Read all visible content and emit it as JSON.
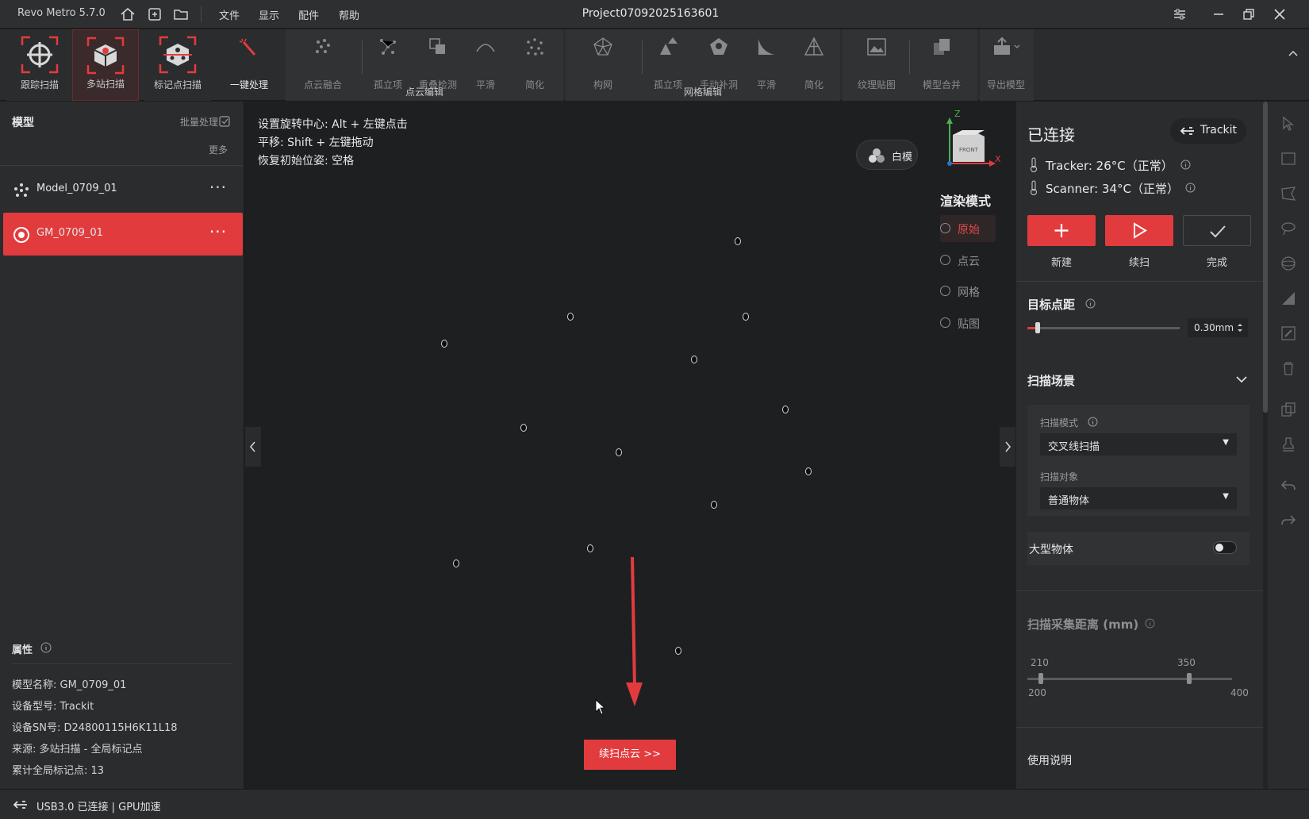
{
  "app": {
    "name_version": "Revo Metro 5.7.0",
    "project": "Project07092025163601",
    "menu": [
      "文件",
      "显示",
      "配件",
      "帮助"
    ]
  },
  "toolbar": {
    "modes": [
      "跟踪扫描",
      "多站扫描",
      "标记点扫描"
    ],
    "one_click": "一键处理",
    "pointcloud_tools": [
      "点云融合",
      "孤立项",
      "重叠检测",
      "平滑",
      "简化"
    ],
    "pointcloud_group": "点云编辑",
    "mesh_tools": [
      "构网",
      "孤立项",
      "手动补洞",
      "平滑",
      "简化"
    ],
    "mesh_group": "网格编辑",
    "texture": "纹理贴图",
    "merge": "模型合并",
    "export": "导出模型"
  },
  "left": {
    "title": "模型",
    "batch": "批量处理",
    "more": "更多",
    "items": [
      {
        "name": "Model_0709_01",
        "dots": "···"
      },
      {
        "name": "GM_0709_01",
        "dots": "···"
      }
    ],
    "props_title": "属性",
    "props": [
      "模型名称: GM_0709_01",
      "设备型号: Trackit",
      "设备SN号: D24800115H6K11L18",
      "来源: 多站扫描 - 全局标记点",
      "累计全局标记点: 13"
    ]
  },
  "viewport": {
    "hints": [
      "设置旋转中心: Alt + 左键点击",
      "平移: Shift + 左键拖动",
      "恢复初始位姿: 空格"
    ],
    "white_model": "白模",
    "render_title": "渲染模式",
    "render_options": [
      "原始",
      "点云",
      "网格",
      "贴图"
    ],
    "render_selected": "原始",
    "axis": {
      "z": "Z",
      "x": "X",
      "face": "FRONT"
    },
    "continue_btn": "续扫点云 >>"
  },
  "right": {
    "status": "已连接",
    "device": "Trackit",
    "tracker": "Tracker: 26°C（正常）",
    "scanner": "Scanner: 34°C（正常）",
    "actions": [
      "新建",
      "续扫",
      "完成"
    ],
    "target_spacing_label": "目标点距",
    "target_spacing_value": "0.30mm",
    "scene_title": "扫描场景",
    "scan_mode_label": "扫描模式",
    "scan_mode_value": "交叉线扫描",
    "scan_object_label": "扫描对象",
    "scan_object_value": "普通物体",
    "large_object": "大型物体",
    "large_object_on": false,
    "distance_title": "扫描采集距离 (mm)",
    "distance_low": "210",
    "distance_high": "350",
    "distance_min": "200",
    "distance_max": "400",
    "usage": "使用说明"
  },
  "status": {
    "text": "USB3.0 已连接 | GPU加速"
  },
  "colors": {
    "accent": "#e23b3e",
    "background": "#1e1f21",
    "panel": "#2b2c2e"
  }
}
